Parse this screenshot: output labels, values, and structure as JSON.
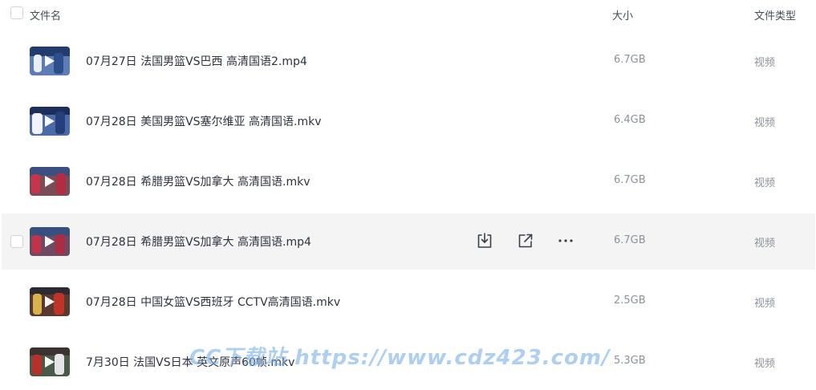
{
  "header": {
    "name_label": "文件名",
    "size_label": "大小",
    "type_label": "文件类型"
  },
  "files": [
    {
      "name": "07月27日 法国男篮VS巴西 高清国语2.mp4",
      "size": "6.7GB",
      "type": "视频"
    },
    {
      "name": "07月28日 美国男篮VS塞尔维亚 高清国语.mkv",
      "size": "6.4GB",
      "type": "视频"
    },
    {
      "name": "07月28日 希腊男篮VS加拿大 高清国语.mkv",
      "size": "6.7GB",
      "type": "视频"
    },
    {
      "name": "07月28日 希腊男篮VS加拿大 高清国语.mp4",
      "size": "6.7GB",
      "type": "视频"
    },
    {
      "name": "07月28日 中国女篮VS西班牙 CCTV高清国语.mkv",
      "size": "2.5GB",
      "type": "视频"
    },
    {
      "name": "7月30日 法国VS日本 英文原声60帧.mkv",
      "size": "5.3GB",
      "type": "视频"
    }
  ],
  "hovered_row_actions": [
    "download-icon",
    "share-icon",
    "more-icon"
  ],
  "watermark": "CC下载站 https://www.cdz423.com/",
  "colors": {
    "text": "#2e3240",
    "muted": "#8c929e",
    "hover_bg": "#f4f4f5",
    "icon": "#3a3f4b"
  }
}
